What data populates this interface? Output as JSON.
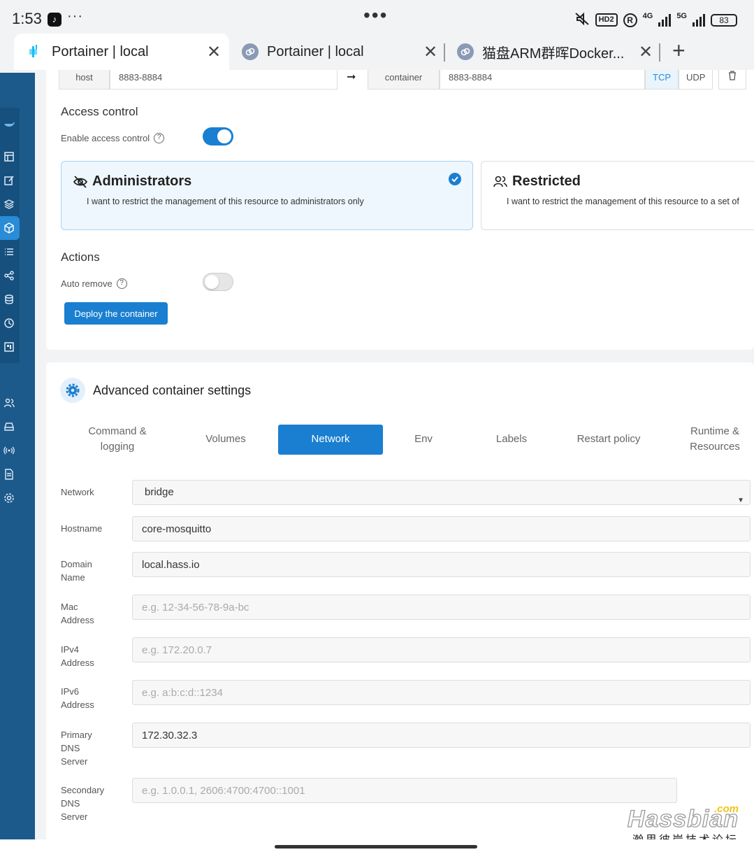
{
  "status_bar": {
    "time": "1:53",
    "app_icon": "tiktok-icon",
    "more": "···",
    "center": "•••",
    "chip": "HD2",
    "roaming": "R",
    "net1": "4G",
    "net2": "5G",
    "battery": "83"
  },
  "browser_tabs": [
    {
      "title": "Portainer | local",
      "icon": "portainer-icon"
    },
    {
      "title": "Portainer | local",
      "icon": "link-icon"
    },
    {
      "title": "猫盘ARM群晖Docker...",
      "icon": "link-icon"
    }
  ],
  "port_mapping": {
    "host_label": "host",
    "host_value": "8883-8884",
    "container_label": "container",
    "container_value": "8883-8884",
    "protocols": [
      "TCP",
      "UDP"
    ],
    "selected_protocol": "TCP"
  },
  "access_control": {
    "section_title": "Access control",
    "enable_label": "Enable access control",
    "enabled": true,
    "options": [
      {
        "title": "Administrators",
        "description": "I want to restrict the management of this resource to administrators only",
        "selected": true,
        "icon": "eye-slash-icon"
      },
      {
        "title": "Restricted",
        "description": "I want to restrict the management of this resource to a set of",
        "selected": false,
        "icon": "users-icon"
      }
    ]
  },
  "actions": {
    "section_title": "Actions",
    "auto_remove_label": "Auto remove",
    "auto_remove": false,
    "deploy_button": "Deploy the container"
  },
  "advanced": {
    "title": "Advanced container settings",
    "tabs": [
      {
        "line1": "Command &",
        "line2": "logging"
      },
      {
        "line1": "Volumes",
        "line2": ""
      },
      {
        "line1": "Network",
        "line2": ""
      },
      {
        "line1": "Env",
        "line2": ""
      },
      {
        "line1": "Labels",
        "line2": ""
      },
      {
        "line1": "Restart policy",
        "line2": ""
      },
      {
        "line1": "Runtime &",
        "line2": "Resources"
      }
    ],
    "active_tab": "Network"
  },
  "network_form": {
    "network_label": "Network",
    "network_value": "bridge",
    "hostname_label_1": "Hostname",
    "hostname_value": "core-mosquitto",
    "domain_label_1": "Domain",
    "domain_label_2": "Name",
    "domain_value": "local.hass.io",
    "mac_label_1": "Mac",
    "mac_label_2": "Address",
    "mac_placeholder": "e.g. 12-34-56-78-9a-bc",
    "ipv4_label_1": "IPv4",
    "ipv4_label_2": "Address",
    "ipv4_placeholder": "e.g. 172.20.0.7",
    "ipv6_label_1": "IPv6",
    "ipv6_label_2": "Address",
    "ipv6_placeholder": "e.g. a:b:c:d::1234",
    "pdns_label_1": "Primary",
    "pdns_label_2": "DNS",
    "pdns_label_3": "Server",
    "pdns_value": "172.30.32.3",
    "sdns_label_1": "Secondary",
    "sdns_label_2": "DNS",
    "sdns_label_3": "Server",
    "sdns_placeholder": "e.g. 1.0.0.1, 2606:4700:4700::1001"
  },
  "watermark": {
    "com": ".com",
    "brand": "Hassbian",
    "cn": "瀚思彼岸技术论坛"
  },
  "colors": {
    "sidebar": "#1c5a8c",
    "accent": "#1a7fd0",
    "page_bg": "#f2f3f5"
  }
}
